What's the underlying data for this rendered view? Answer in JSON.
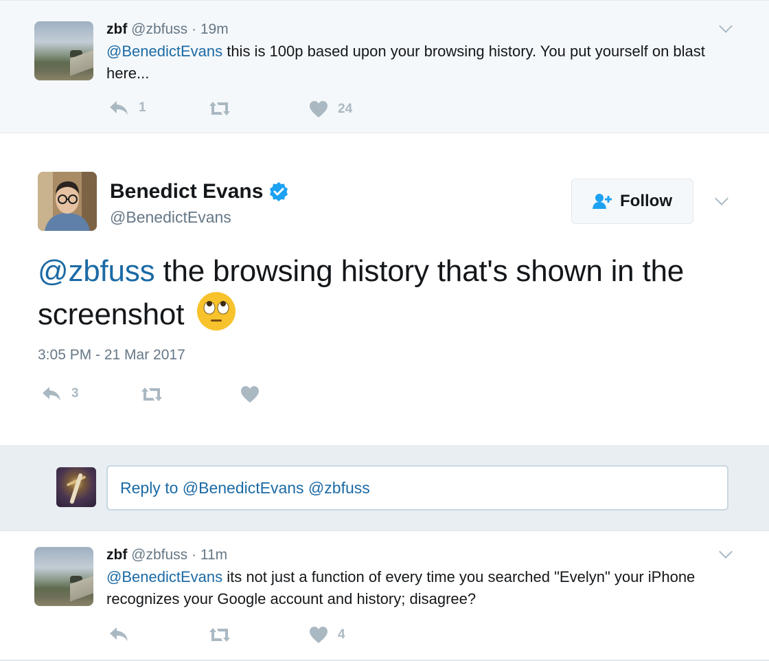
{
  "parent_tweet": {
    "name": "zbf",
    "handle": "@zbfuss",
    "time": "· 19m",
    "mention": "@BenedictEvans",
    "text": " this is 100p based upon your browsing history. You put yourself on blast here...",
    "reply_count": "1",
    "retweet_count": "",
    "like_count": "24"
  },
  "main_tweet": {
    "name": "Benedict Evans",
    "handle": "@BenedictEvans",
    "follow_label": "Follow",
    "mention": "@zbfuss",
    "text": " the browsing history that's shown in the screenshot",
    "timestamp": "3:05 PM - 21 Mar 2017",
    "reply_count": "3",
    "retweet_count": "",
    "like_count": ""
  },
  "reply_box": {
    "placeholder": "Reply to @BenedictEvans @zbfuss"
  },
  "reply_tweet": {
    "name": "zbf",
    "handle": "@zbfuss",
    "time": "· 11m",
    "mention": "@BenedictEvans",
    "text": " its not just a function of every time you searched \"Evelyn\" your iPhone recognizes your Google account and history; disagree?",
    "reply_count": "",
    "retweet_count": "",
    "like_count": "4"
  },
  "colors": {
    "link": "#1b6aa5",
    "muted": "#657786",
    "icon": "#aab8c2",
    "verified": "#1da1f2"
  },
  "icons": {
    "reply": "reply-icon",
    "retweet": "retweet-icon",
    "like": "heart-icon",
    "verified": "verified-badge-icon",
    "follow": "add-user-icon",
    "caret": "chevron-down-icon",
    "emoji": "face-with-rolling-eyes-emoji"
  }
}
